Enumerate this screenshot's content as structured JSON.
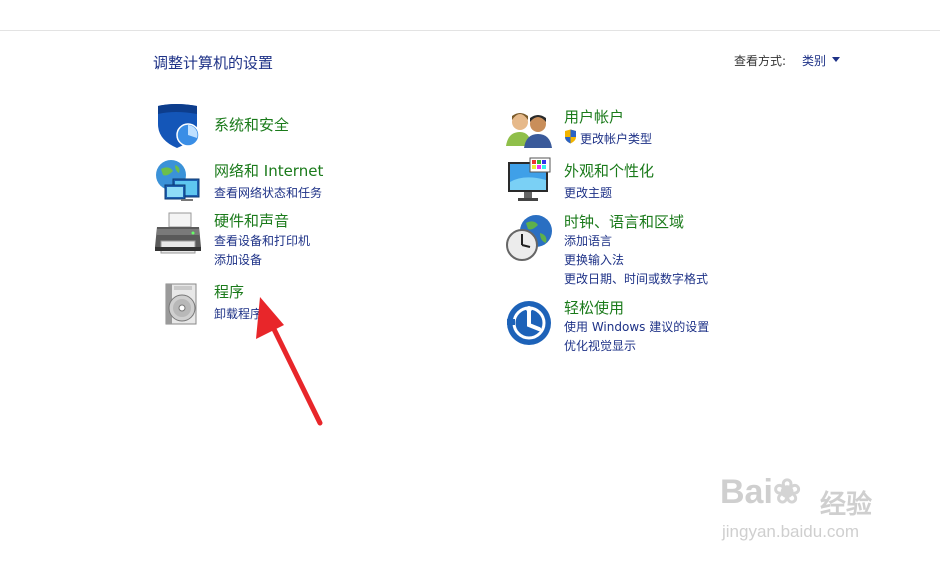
{
  "header": {
    "title": "调整计算机的设置",
    "view_by_label": "查看方式:",
    "view_by_value": "类别"
  },
  "categories": {
    "security": {
      "title": "系统和安全",
      "icon": "shield-icon"
    },
    "network": {
      "title": "网络和 Internet",
      "links": [
        "查看网络状态和任务"
      ],
      "icon": "network-globe-icon"
    },
    "hardware": {
      "title": "硬件和声音",
      "links": [
        "查看设备和打印机",
        "添加设备"
      ],
      "icon": "printer-icon"
    },
    "programs": {
      "title": "程序",
      "links": [
        "卸载程序"
      ],
      "icon": "programs-disc-icon"
    },
    "users": {
      "title": "用户帐户",
      "links": [
        "更改帐户类型"
      ],
      "icon": "users-icon"
    },
    "appearance": {
      "title": "外观和个性化",
      "links": [
        "更改主题"
      ],
      "icon": "monitor-palette-icon"
    },
    "clock": {
      "title": "时钟、语言和区域",
      "links": [
        "添加语言",
        "更换输入法",
        "更改日期、时间或数字格式"
      ],
      "icon": "clock-globe-icon"
    },
    "ease": {
      "title": "轻松使用",
      "links": [
        "使用 Windows 建议的设置",
        "优化视觉显示"
      ],
      "icon": "ease-of-access-icon"
    }
  },
  "watermark": {
    "logo": "Bai 经验",
    "url": "jingyan.baidu.com"
  },
  "colors": {
    "title_green": "#1a7a1a",
    "link_blue": "#1e3287",
    "arrow_red": "#e8262a"
  }
}
